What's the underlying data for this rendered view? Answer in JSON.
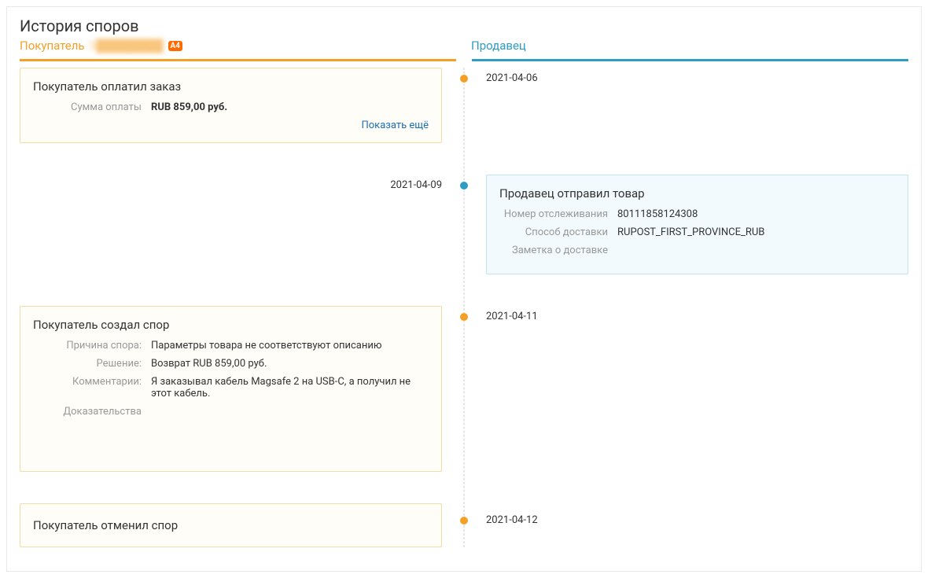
{
  "title": "История споров",
  "headers": {
    "buyer_label": "Покупатель",
    "buyer_name": "S████████",
    "buyer_badge": "A4",
    "seller_label": "Продавец"
  },
  "events": [
    {
      "date": "2021-04-06",
      "buyer_card": {
        "title": "Покупатель оплатил заказ",
        "rows": [
          {
            "k": "Сумма оплаты",
            "v": "RUB 859,00 руб.",
            "bold": true
          }
        ],
        "show_more": "Показать ещё"
      }
    },
    {
      "date": "2021-04-09",
      "seller_card": {
        "title": "Продавец отправил товар",
        "rows": [
          {
            "k": "Номер отслеживания",
            "v": "80111858124308"
          },
          {
            "k": "Способ доставки",
            "v": "RUPOST_FIRST_PROVINCE_RUB"
          },
          {
            "k": "Заметка о доставке",
            "v": ""
          }
        ]
      }
    },
    {
      "date": "2021-04-11",
      "buyer_card": {
        "title": "Покупатель создал спор",
        "rows": [
          {
            "k": "Причина спора:",
            "v": "Параметры товара не соответствуют описанию"
          },
          {
            "k": "Решение:",
            "v": "Возврат RUB 859,00 руб."
          },
          {
            "k": "Комментарии:",
            "v": "Я заказывал кабель Magsafe 2 на USB-C, а получил не этот кабель."
          },
          {
            "k": "Доказательства",
            "v": ""
          }
        ]
      }
    },
    {
      "date": "2021-04-12",
      "buyer_card": {
        "title": "Покупатель отменил спор",
        "simple": true
      }
    }
  ]
}
